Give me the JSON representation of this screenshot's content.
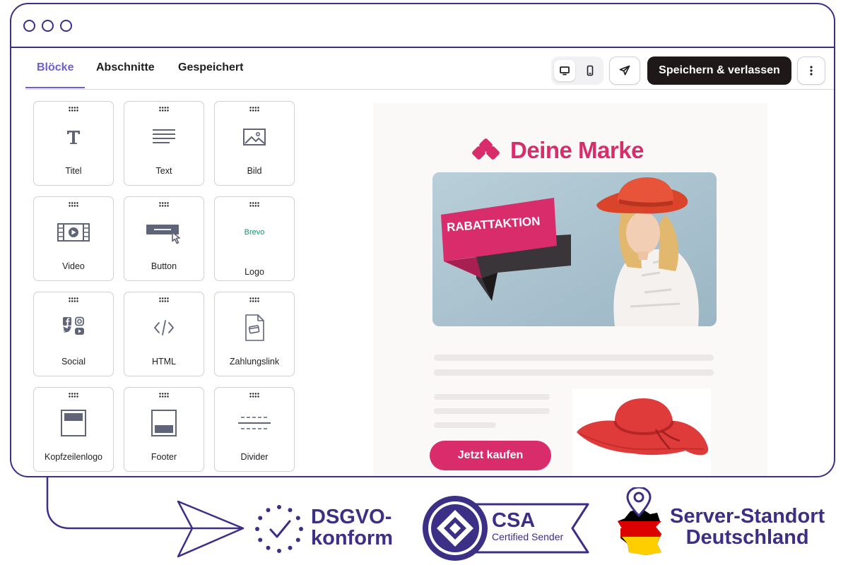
{
  "tabs": [
    "Blöcke",
    "Abschnitte",
    "Gespeichert"
  ],
  "toolbar": {
    "save_label": "Speichern & verlassen"
  },
  "blocks": [
    "Titel",
    "Text",
    "Bild",
    "Video",
    "Button",
    "Logo",
    "Social",
    "HTML",
    "Zahlungslink",
    "Kopfzeilenlogo",
    "Footer",
    "Divider"
  ],
  "logo_block_text": "Brevo",
  "preview": {
    "brand": "Deine Marke",
    "ribbon": "RABATTAKTION",
    "cta": "Jetzt kaufen"
  },
  "badges": {
    "dsgvo_line1": "DSGVO-",
    "dsgvo_line2": "konform",
    "csa_title": "CSA",
    "csa_subtitle": "Certified Sender",
    "server_line1": "Server-Standort",
    "server_line2": "Deutschland"
  },
  "colors": {
    "frame": "#3c2f86",
    "accent": "#6d5fd5",
    "brand_pink": "#d92d6b",
    "save_button": "#1e1818",
    "preview_bg": "#fbf9f8"
  }
}
